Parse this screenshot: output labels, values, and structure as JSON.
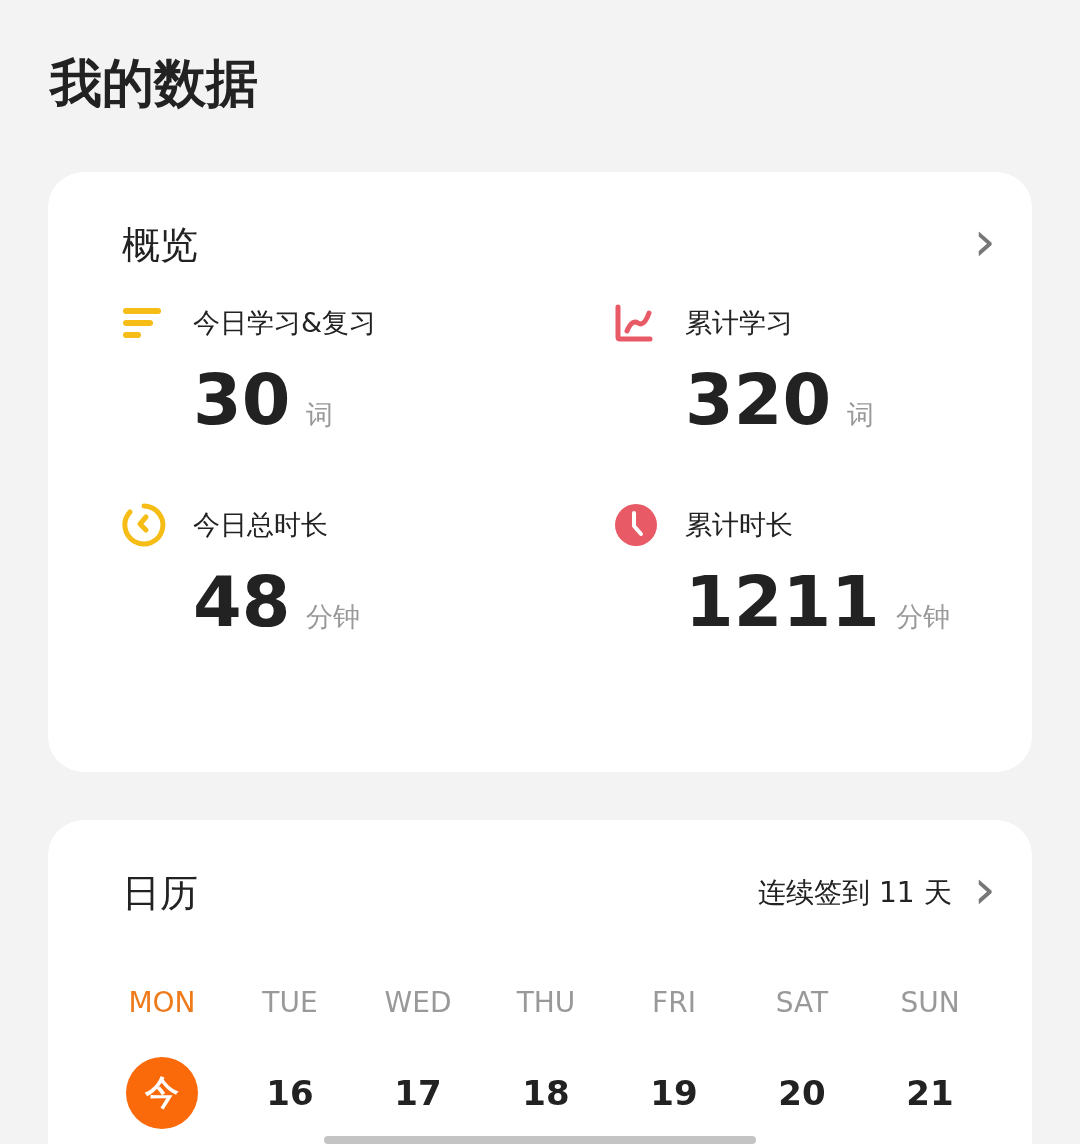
{
  "page_title": "我的数据",
  "overview": {
    "title": "概览",
    "chevron": "›",
    "stats": [
      {
        "kind": "list",
        "label": "今日学习&复习",
        "value": "30",
        "unit": "词"
      },
      {
        "kind": "trend",
        "label": "累计学习",
        "value": "320",
        "unit": "词"
      },
      {
        "kind": "timer",
        "label": "今日总时长",
        "value": "48",
        "unit": "分钟"
      },
      {
        "kind": "clock",
        "label": "累计时长",
        "value": "1211",
        "unit": "分钟"
      }
    ]
  },
  "calendar": {
    "title": "日历",
    "streak": "连续签到 11 天",
    "chevron": "›",
    "days": [
      {
        "weekday": "MON",
        "date": "今",
        "selected": true
      },
      {
        "weekday": "TUE",
        "date": "16",
        "selected": false
      },
      {
        "weekday": "WED",
        "date": "17",
        "selected": false
      },
      {
        "weekday": "THU",
        "date": "18",
        "selected": false
      },
      {
        "weekday": "FRI",
        "date": "19",
        "selected": false
      },
      {
        "weekday": "SAT",
        "date": "20",
        "selected": false
      },
      {
        "weekday": "SUN",
        "date": "21",
        "selected": false
      }
    ]
  }
}
